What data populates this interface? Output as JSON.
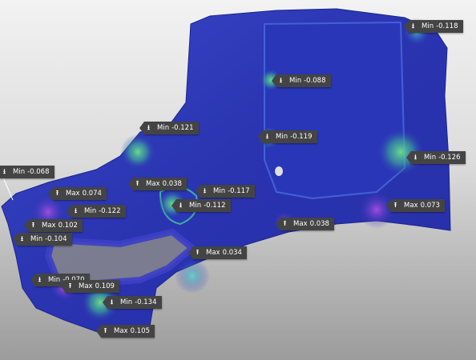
{
  "callouts": [
    {
      "id": "min-118",
      "kind": "Min",
      "value": "-0.118",
      "icon": "min-arrow-icon"
    },
    {
      "id": "min-088",
      "kind": "Min",
      "value": "-0.088",
      "icon": "min-arrow-icon"
    },
    {
      "id": "min-121",
      "kind": "Min",
      "value": "-0.121",
      "icon": "min-arrow-icon"
    },
    {
      "id": "min-119",
      "kind": "Min",
      "value": "-0.119",
      "icon": "min-arrow-icon"
    },
    {
      "id": "min-126",
      "kind": "Min",
      "value": "-0.126",
      "icon": "min-arrow-icon"
    },
    {
      "id": "min-068",
      "kind": "Min",
      "value": "-0.068",
      "icon": "min-arrow-icon"
    },
    {
      "id": "max-038a",
      "kind": "Max",
      "value": "0.038",
      "icon": "max-arrow-icon"
    },
    {
      "id": "min-117",
      "kind": "Min",
      "value": "-0.117",
      "icon": "min-arrow-icon"
    },
    {
      "id": "max-074",
      "kind": "Max",
      "value": "0.074",
      "icon": "max-arrow-icon"
    },
    {
      "id": "min-112",
      "kind": "Min",
      "value": "-0.112",
      "icon": "min-arrow-icon"
    },
    {
      "id": "max-073",
      "kind": "Max",
      "value": "0.073",
      "icon": "max-arrow-icon"
    },
    {
      "id": "min-122",
      "kind": "Min",
      "value": "-0.122",
      "icon": "min-arrow-icon"
    },
    {
      "id": "max-038b",
      "kind": "Max",
      "value": "0.038",
      "icon": "max-arrow-icon"
    },
    {
      "id": "max-102",
      "kind": "Max",
      "value": "0.102",
      "icon": "max-arrow-icon"
    },
    {
      "id": "min-104",
      "kind": "Min",
      "value": "-0.104",
      "icon": "min-arrow-icon"
    },
    {
      "id": "max-034",
      "kind": "Max",
      "value": "0.034",
      "icon": "max-arrow-icon"
    },
    {
      "id": "min-070",
      "kind": "Min",
      "value": "-0.070",
      "icon": "min-arrow-icon"
    },
    {
      "id": "max-109",
      "kind": "Max",
      "value": "0.109",
      "icon": "max-arrow-icon"
    },
    {
      "id": "min-134",
      "kind": "Min",
      "value": "-0.134",
      "icon": "min-arrow-icon"
    },
    {
      "id": "max-105",
      "kind": "Max",
      "value": "0.105",
      "icon": "max-arrow-icon"
    }
  ],
  "glyphs": {
    "min_arrow": "⭳",
    "max_arrow": "⭱"
  }
}
